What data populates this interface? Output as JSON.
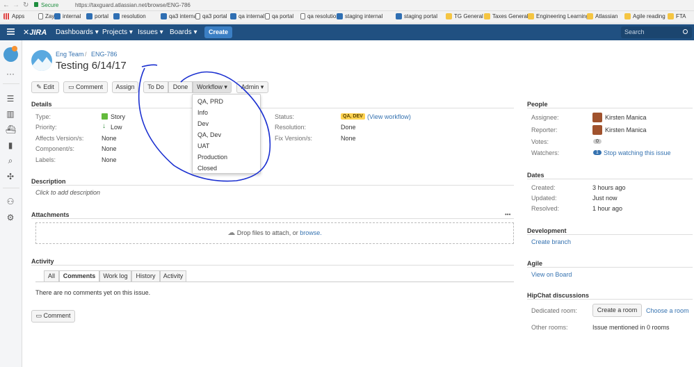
{
  "browser": {
    "secure_label": "Secure",
    "url": "https://taxguard.atlassian.net/browse/ENG-786",
    "bookmarks": [
      {
        "label": "Apps",
        "icon": "apps-grid-icon"
      },
      {
        "label": "Zayo",
        "icon": "doc-icon"
      },
      {
        "label": "internal",
        "icon": "shield-icon"
      },
      {
        "label": "portal",
        "icon": "shield-icon"
      },
      {
        "label": "resolution",
        "icon": "shield-icon"
      },
      {
        "label": "qa3 internal",
        "icon": "shield-icon"
      },
      {
        "label": "qa3 portal",
        "icon": "doc-icon"
      },
      {
        "label": "qa internal",
        "icon": "shield-icon"
      },
      {
        "label": "qa portal",
        "icon": "doc-icon"
      },
      {
        "label": "qa resolution",
        "icon": "doc-icon"
      },
      {
        "label": "staging internal",
        "icon": "shield-icon"
      },
      {
        "label": "staging portal",
        "icon": "shield-icon"
      },
      {
        "label": "TG General",
        "icon": "folder-icon"
      },
      {
        "label": "Taxes General",
        "icon": "folder-icon"
      },
      {
        "label": "Engineering Learning",
        "icon": "folder-icon"
      },
      {
        "label": "Atlassian",
        "icon": "folder-icon"
      },
      {
        "label": "Agile reading",
        "icon": "folder-icon"
      },
      {
        "label": "FTA",
        "icon": "folder-icon"
      }
    ]
  },
  "nav": {
    "logo": "JIRA",
    "items": [
      "Dashboards",
      "Projects",
      "Issues",
      "Boards"
    ],
    "create": "Create",
    "search_placeholder": "Search"
  },
  "issue": {
    "project": "Eng Team",
    "separator": "/",
    "key": "ENG-786",
    "title": "Testing 6/14/17"
  },
  "toolbar": {
    "edit": "Edit",
    "comment": "Comment",
    "assign": "Assign",
    "todo": "To Do",
    "done": "Done",
    "workflow": "Workflow",
    "admin": "Admin"
  },
  "workflow_menu": [
    "QA, PRD",
    "Info",
    "Dev",
    "QA, Dev",
    "UAT",
    "Production",
    "Closed"
  ],
  "details": {
    "heading": "Details",
    "type_label": "Type:",
    "type_value": "Story",
    "priority_label": "Priority:",
    "priority_value": "Low",
    "affects_label": "Affects Version/s:",
    "affects_value": "None",
    "component_label": "Component/s:",
    "component_value": "None",
    "labels_label": "Labels:",
    "labels_value": "None",
    "status_label": "Status:",
    "status_value": "QA, DEV",
    "view_workflow": "(View workflow)",
    "resolution_label": "Resolution:",
    "resolution_value": "Done",
    "fix_label": "Fix Version/s:",
    "fix_value": "None"
  },
  "description": {
    "heading": "Description",
    "placeholder": "Click to add description"
  },
  "attachments": {
    "heading": "Attachments",
    "drop_text": "Drop files to attach, or",
    "browse": "browse.",
    "more": "•••"
  },
  "activity": {
    "heading": "Activity",
    "tabs": [
      "All",
      "Comments",
      "Work log",
      "History",
      "Activity"
    ],
    "active_tab": "Comments",
    "empty": "There are no comments yet on this issue.",
    "comment_button": "Comment"
  },
  "people": {
    "heading": "People",
    "assignee_label": "Assignee:",
    "assignee": "Kirsten Manica",
    "reporter_label": "Reporter:",
    "reporter": "Kirsten Manica",
    "votes_label": "Votes:",
    "votes": "0",
    "watchers_label": "Watchers:",
    "watchers": "1",
    "stop_watching": "Stop watching this issue"
  },
  "dates": {
    "heading": "Dates",
    "created_label": "Created:",
    "created": "3 hours ago",
    "updated_label": "Updated:",
    "updated": "Just now",
    "resolved_label": "Resolved:",
    "resolved": "1 hour ago"
  },
  "development": {
    "heading": "Development",
    "create_branch": "Create branch"
  },
  "agile": {
    "heading": "Agile",
    "view_on_board": "View on Board"
  },
  "hipchat": {
    "heading": "HipChat discussions",
    "dedicated_label": "Dedicated room:",
    "create_room": "Create a room",
    "choose_room": "Choose a room",
    "other_label": "Other rooms:",
    "other_value": "Issue mentioned in 0 rooms"
  },
  "colors": {
    "nav": "#205081",
    "link": "#3572b0",
    "status_bg": "#ffd351",
    "annotation": "#1a2fd0"
  }
}
